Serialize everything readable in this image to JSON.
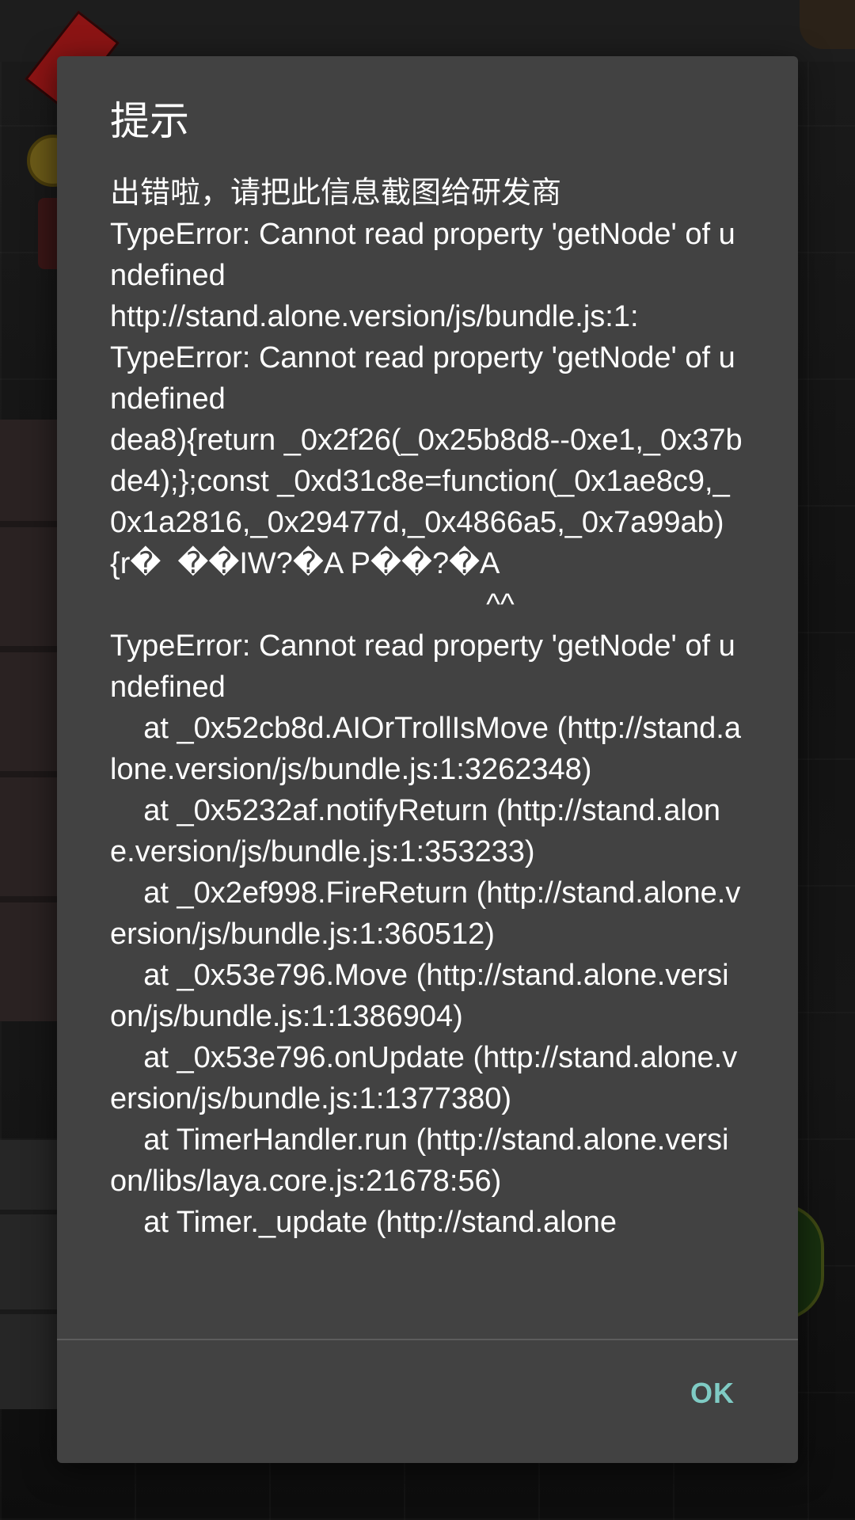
{
  "dialog": {
    "title": "提示",
    "message": "出错啦，请把此信息截图给研发商\nTypeError: Cannot read property 'getNode' of undefined\nhttp://stand.alone.version/js/bundle.js:1:\nTypeError: Cannot read property 'getNode' of undefined\ndea8){return _0x2f26(_0x25b8d8--0xe1,_0x37bde4);};const _0xd31c8e=function(_0x1ae8c9,_0x1a2816,_0x29477d,_0x4866a5,_0x7a99ab){r�  ��IW?�A P��?�A\n                                             ^^\nTypeError: Cannot read property 'getNode' of undefined\n    at _0x52cb8d.AIOrTrollIsMove (http://stand.alone.version/js/bundle.js:1:3262348)\n    at _0x5232af.notifyReturn (http://stand.alone.version/js/bundle.js:1:353233)\n    at _0x2ef998.FireReturn (http://stand.alone.version/js/bundle.js:1:360512)\n    at _0x53e796.Move (http://stand.alone.version/js/bundle.js:1:1386904)\n    at _0x53e796.onUpdate (http://stand.alone.version/js/bundle.js:1:1377380)\n    at TimerHandler.run (http://stand.alone.version/libs/laya.core.js:21678:56)\n    at Timer._update (http://stand.alone",
    "ok_label": "OK"
  },
  "colors": {
    "dialog_bg": "#424242",
    "text": "#ffffff",
    "accent": "#7fcbc4"
  }
}
